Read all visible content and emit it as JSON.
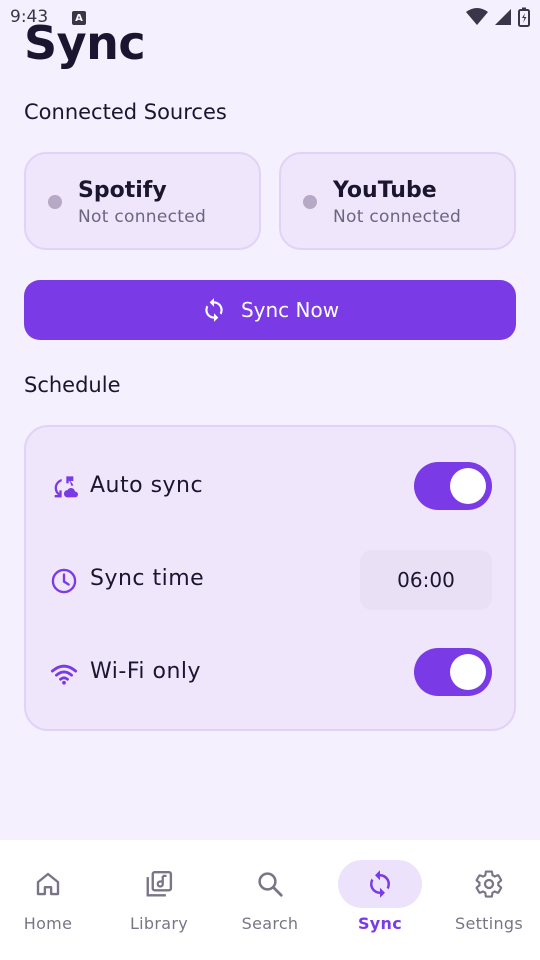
{
  "status_bar": {
    "time": "9:43",
    "badge": "A"
  },
  "page_title": "Sync",
  "sources": {
    "title": "Connected Sources",
    "items": [
      {
        "name": "Spotify",
        "status": "Not connected"
      },
      {
        "name": "YouTube",
        "status": "Not connected"
      }
    ]
  },
  "sync_button": {
    "label": "Sync Now",
    "icon": "sync-icon"
  },
  "schedule": {
    "title": "Schedule",
    "auto_sync": {
      "label": "Auto sync",
      "enabled": true,
      "icon": "cloud-sync-icon"
    },
    "sync_time": {
      "label": "Sync time",
      "value": "06:00",
      "icon": "clock-icon"
    },
    "wifi_only": {
      "label": "Wi-Fi only",
      "enabled": true,
      "icon": "wifi-icon"
    }
  },
  "nav": {
    "items": [
      {
        "label": "Home",
        "icon": "home-icon"
      },
      {
        "label": "Library",
        "icon": "library-icon"
      },
      {
        "label": "Search",
        "icon": "search-icon"
      },
      {
        "label": "Sync",
        "icon": "sync-icon",
        "active": true
      },
      {
        "label": "Settings",
        "icon": "gear-icon"
      }
    ]
  },
  "colors": {
    "accent": "#7a3ae6",
    "background": "#f4f0fd",
    "card": "#efe6fc"
  }
}
